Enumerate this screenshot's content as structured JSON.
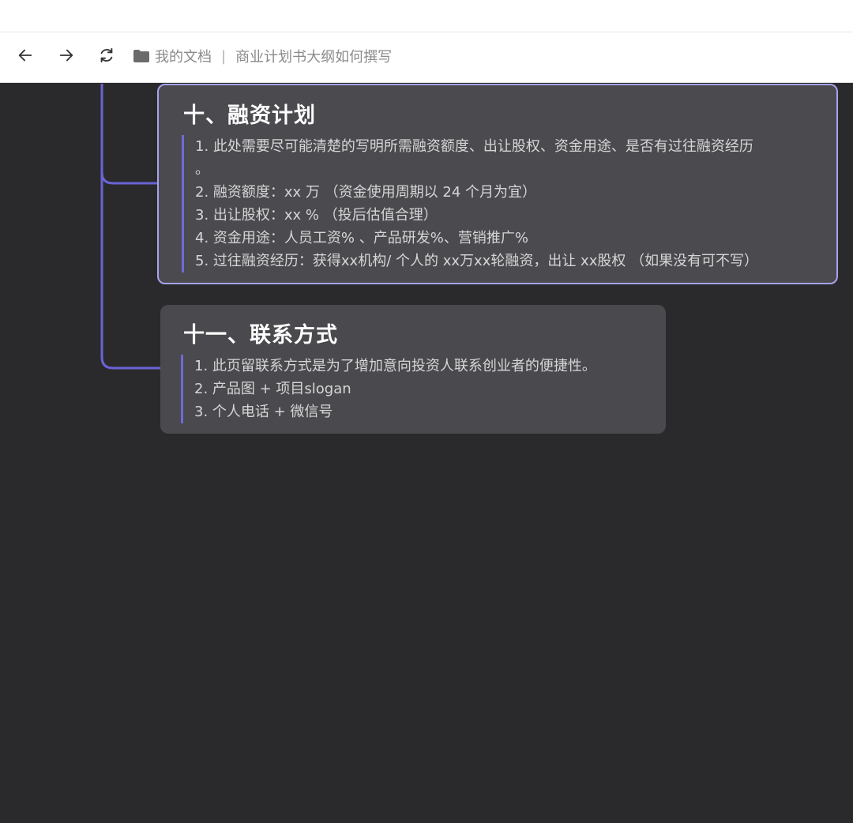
{
  "toolbar": {
    "back_icon": "arrow-left-icon",
    "forward_icon": "arrow-right-icon",
    "refresh_icon": "refresh-icon",
    "folder_icon": "folder-icon",
    "breadcrumb_root": "我的文档",
    "breadcrumb_separator": "|",
    "doc_title": "商业计划书大纲如何撰写"
  },
  "mindmap": {
    "connector_color": "#6a63d6",
    "selected_border_color": "#a6a2ef",
    "nodes": [
      {
        "title": "十、融资计划",
        "selected": true,
        "lines": [
          "1. 此处需要尽可能清楚的写明所需融资额度、出让股权、资金用途、是否有过往融资经历",
          "。",
          "2. 融资额度：xx 万 （资金使用周期以 24 个月为宜）",
          "3. 出让股权：xx % （投后估值合理）",
          "4. 资金用途：人员工资% 、产品研发%、营销推广%",
          "5. 过往融资经历：获得xx机构/ 个人的 xx万xx轮融资，出让 xx股权 （如果没有可不写）"
        ]
      },
      {
        "title": "十一、联系方式",
        "selected": false,
        "lines": [
          "1. 此页留联系方式是为了增加意向投资人联系创业者的便捷性。",
          "2. 产品图 + 项目slogan",
          "3. 个人电话 + 微信号"
        ]
      }
    ]
  }
}
